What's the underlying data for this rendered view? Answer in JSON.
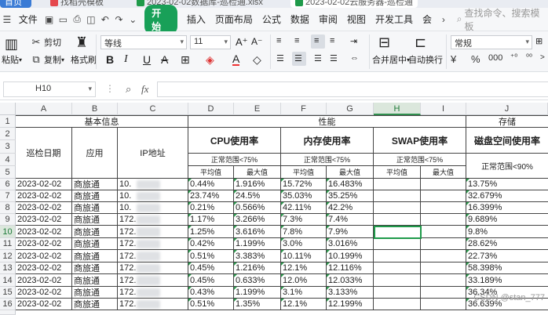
{
  "tabs": {
    "home": "首页",
    "t1": "找稻壳模板",
    "t2": "2023-02-02数据库-巡检通.xlsx",
    "t3": "2023-02-02云服务器-巡检通"
  },
  "menu": {
    "file": "文件",
    "start": "开始",
    "items": [
      "插入",
      "页面布局",
      "公式",
      "数据",
      "审阅",
      "视图",
      "开发工具",
      "会"
    ],
    "search_placeholder": "查找命令、搜索模板"
  },
  "ribbon": {
    "cut": "剪切",
    "paste": "粘贴",
    "copy": "复制",
    "format_painter": "格式刷",
    "font_name": "等线",
    "font_size": "11",
    "merge_center": "合并居中",
    "wrap_text": "自动换行",
    "number_format": "常规"
  },
  "formula_bar": {
    "name_box": "H10",
    "fx": "fx",
    "value": ""
  },
  "columns": [
    "A",
    "B",
    "C",
    "D",
    "E",
    "F",
    "G",
    "H",
    "I",
    "J"
  ],
  "rows": [
    "1",
    "2",
    "3",
    "4",
    "5",
    "6",
    "7",
    "8",
    "9",
    "10",
    "11",
    "12",
    "13",
    "14",
    "15",
    "16"
  ],
  "headers": {
    "basic_info": "基本信息",
    "performance": "性能",
    "storage": "存储",
    "inspect_date": "巡检日期",
    "app": "应用",
    "ip": "IP地址",
    "cpu": "CPU使用率",
    "mem": "内存使用率",
    "swap": "SWAP使用率",
    "disk": "磁盘空间使用率",
    "normal_75": "正常范围<75%",
    "normal_90": "正常范围<90%",
    "avg": "平均值",
    "max": "最大值"
  },
  "table_rows": [
    {
      "date": "2023-02-02",
      "app": "商旅通",
      "ip": "10.",
      "cpu_avg": "0.44%",
      "cpu_max": "1.916%",
      "mem_avg": "15.72%",
      "mem_max": "16.483%",
      "disk": "13.75%"
    },
    {
      "date": "2023-02-02",
      "app": "商旅通",
      "ip": "10.",
      "cpu_avg": "23.74%",
      "cpu_max": "24.5%",
      "mem_avg": "35.03%",
      "mem_max": "35.25%",
      "disk": "32.679%"
    },
    {
      "date": "2023-02-02",
      "app": "商旅通",
      "ip": "10.",
      "cpu_avg": "0.21%",
      "cpu_max": "0.566%",
      "mem_avg": "42.11%",
      "mem_max": "42.2%",
      "disk": "16.399%"
    },
    {
      "date": "2023-02-02",
      "app": "商旅通",
      "ip": "172.",
      "cpu_avg": "1.17%",
      "cpu_max": "3.266%",
      "mem_avg": "7.3%",
      "mem_max": "7.4%",
      "disk": "9.689%"
    },
    {
      "date": "2023-02-02",
      "app": "商旅通",
      "ip": "172.",
      "cpu_avg": "1.25%",
      "cpu_max": "3.616%",
      "mem_avg": "7.8%",
      "mem_max": "7.9%",
      "disk": "9.8%"
    },
    {
      "date": "2023-02-02",
      "app": "商旅通",
      "ip": "172.",
      "cpu_avg": "0.42%",
      "cpu_max": "1.199%",
      "mem_avg": "3.0%",
      "mem_max": "3.016%",
      "disk": "28.62%"
    },
    {
      "date": "2023-02-02",
      "app": "商旅通",
      "ip": "172.",
      "cpu_avg": "0.51%",
      "cpu_max": "3.383%",
      "mem_avg": "10.11%",
      "mem_max": "10.199%",
      "disk": "22.73%"
    },
    {
      "date": "2023-02-02",
      "app": "商旅通",
      "ip": "172.",
      "cpu_avg": "0.45%",
      "cpu_max": "1.216%",
      "mem_avg": "12.1%",
      "mem_max": "12.116%",
      "disk": "58.398%"
    },
    {
      "date": "2023-02-02",
      "app": "商旅通",
      "ip": "172.",
      "cpu_avg": "0.45%",
      "cpu_max": "0.633%",
      "mem_avg": "12.0%",
      "mem_max": "12.033%",
      "disk": "33.189%"
    },
    {
      "date": "2023-02-02",
      "app": "商旅通",
      "ip": "172.",
      "cpu_avg": "0.43%",
      "cpu_max": "1.199%",
      "mem_avg": "3.1%",
      "mem_max": "3.133%",
      "disk": "36.34%"
    },
    {
      "date": "2023-02-02",
      "app": "商旅通",
      "ip": "172.",
      "cpu_avg": "0.51%",
      "cpu_max": "1.35%",
      "mem_avg": "12.1%",
      "mem_max": "12.199%",
      "disk": "36.639%"
    }
  ],
  "watermark": "CSDN @stan_777"
}
